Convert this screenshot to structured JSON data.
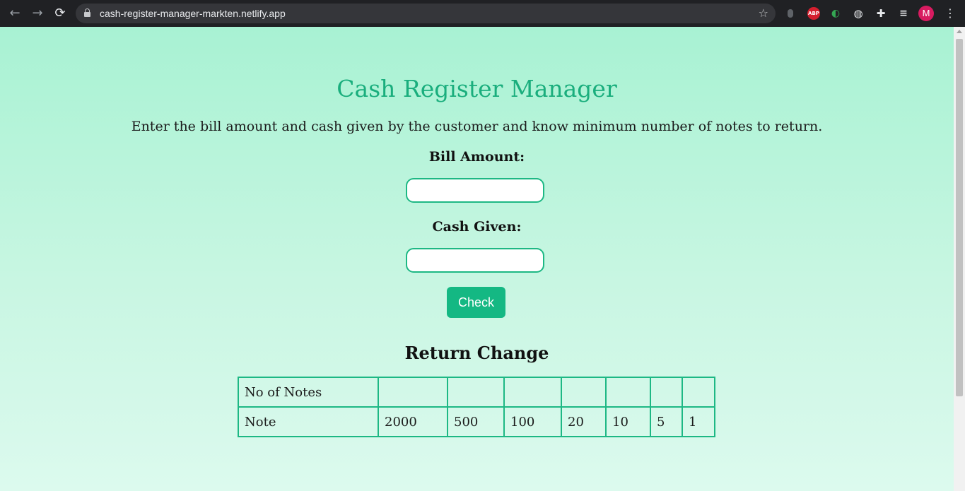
{
  "browser": {
    "url": "cash-register-manager-markten.netlify.app",
    "profile_initial": "M",
    "extensions": [
      "ABP"
    ]
  },
  "page": {
    "title": "Cash Register Manager",
    "description": "Enter the bill amount and cash given by the customer and know minimum number of notes to return.",
    "bill_label": "Bill Amount:",
    "bill_value": "",
    "cash_label": "Cash Given:",
    "cash_value": "",
    "check_label": "Check",
    "return_heading": "Return Change",
    "table": {
      "row1_header": "No of Notes",
      "row1_values": [
        "",
        "",
        "",
        "",
        "",
        "",
        ""
      ],
      "row2_header": "Note",
      "notes": [
        "2000",
        "500",
        "100",
        "20",
        "10",
        "5",
        "1"
      ]
    }
  },
  "colors": {
    "accent": "#1aae7d",
    "border": "#1db884",
    "button": "#14b883"
  }
}
